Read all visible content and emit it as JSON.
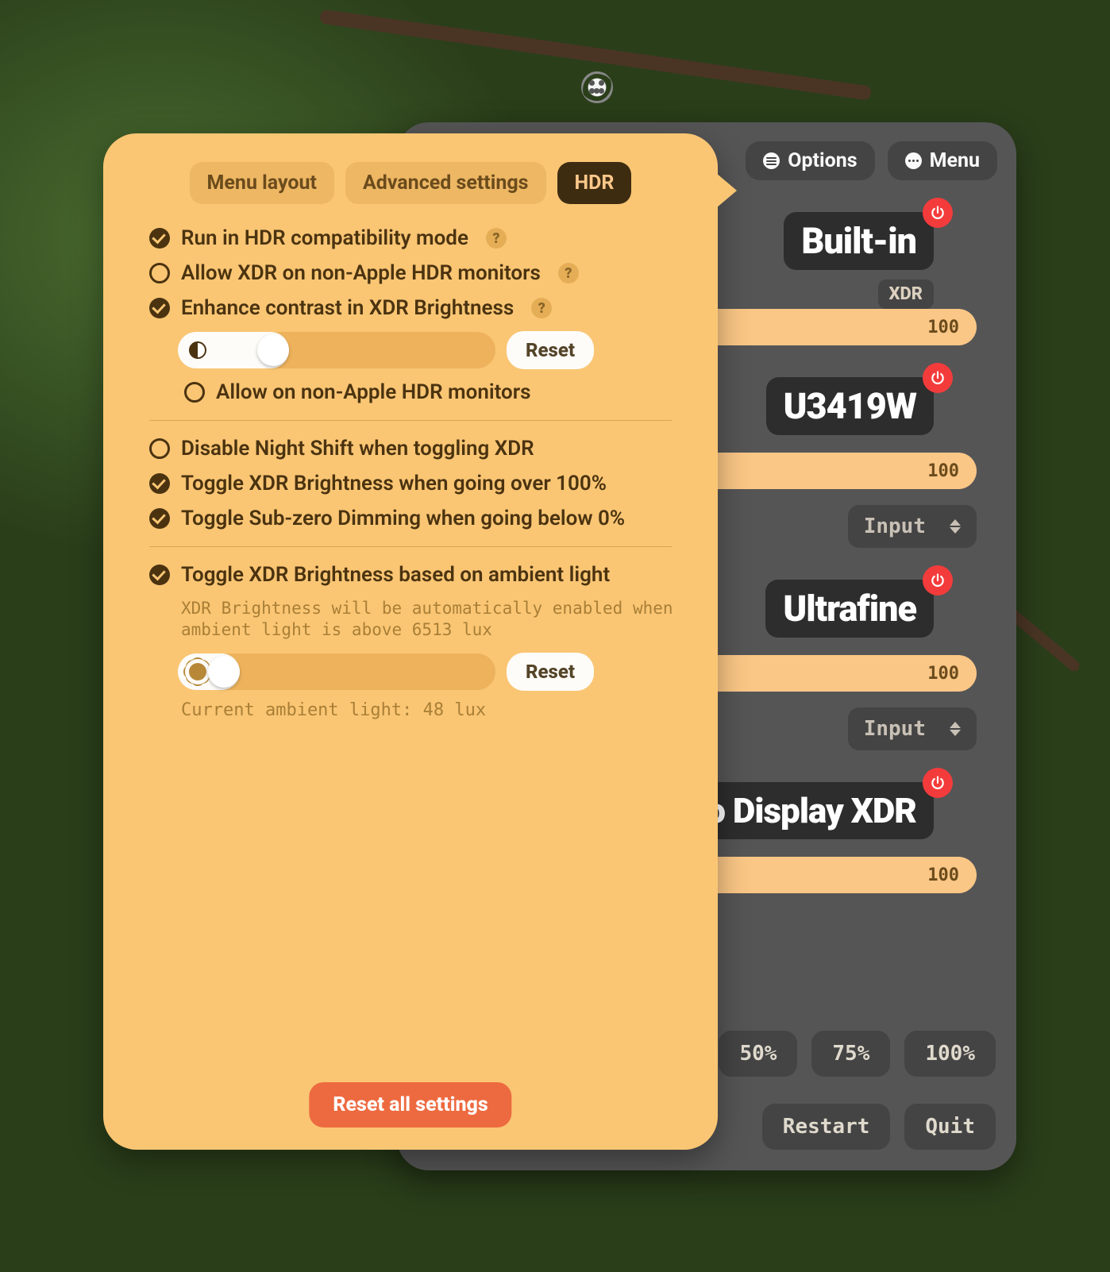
{
  "topbar": {
    "options": "Options",
    "menu": "Menu"
  },
  "displays": [
    {
      "name": "Built-in",
      "badge": "XDR",
      "value": "100",
      "input": null
    },
    {
      "name": "U3419W",
      "badge": null,
      "value": "100",
      "input": "Input"
    },
    {
      "name": "Ultrafine",
      "badge": null,
      "value": "100",
      "input": "Input"
    },
    {
      "name": "Pro Display XDR",
      "badge": null,
      "value": "100",
      "input": null
    }
  ],
  "presets": [
    "50%",
    "75%",
    "100%"
  ],
  "actions": {
    "restart": "Restart",
    "quit": "Quit"
  },
  "tabs": {
    "menu_layout": "Menu layout",
    "advanced": "Advanced settings",
    "hdr": "HDR"
  },
  "settings": {
    "hdr_compat": "Run in HDR compatibility mode",
    "allow_xdr_non_apple": "Allow XDR on non-Apple HDR monitors",
    "enhance_contrast": "Enhance contrast in XDR Brightness",
    "allow_non_apple": "Allow on non-Apple HDR monitors",
    "disable_night_shift": "Disable Night Shift when toggling XDR",
    "toggle_over_100": "Toggle XDR Brightness when going over 100%",
    "toggle_below_0": "Toggle Sub-zero Dimming when going below 0%",
    "toggle_ambient": "Toggle XDR Brightness based on ambient light",
    "ambient_desc": "XDR Brightness will be automatically enabled when ambient light is above 6513 lux",
    "current_lux": "Current ambient light: 48 lux",
    "reset": "Reset",
    "reset_all": "Reset all settings"
  }
}
